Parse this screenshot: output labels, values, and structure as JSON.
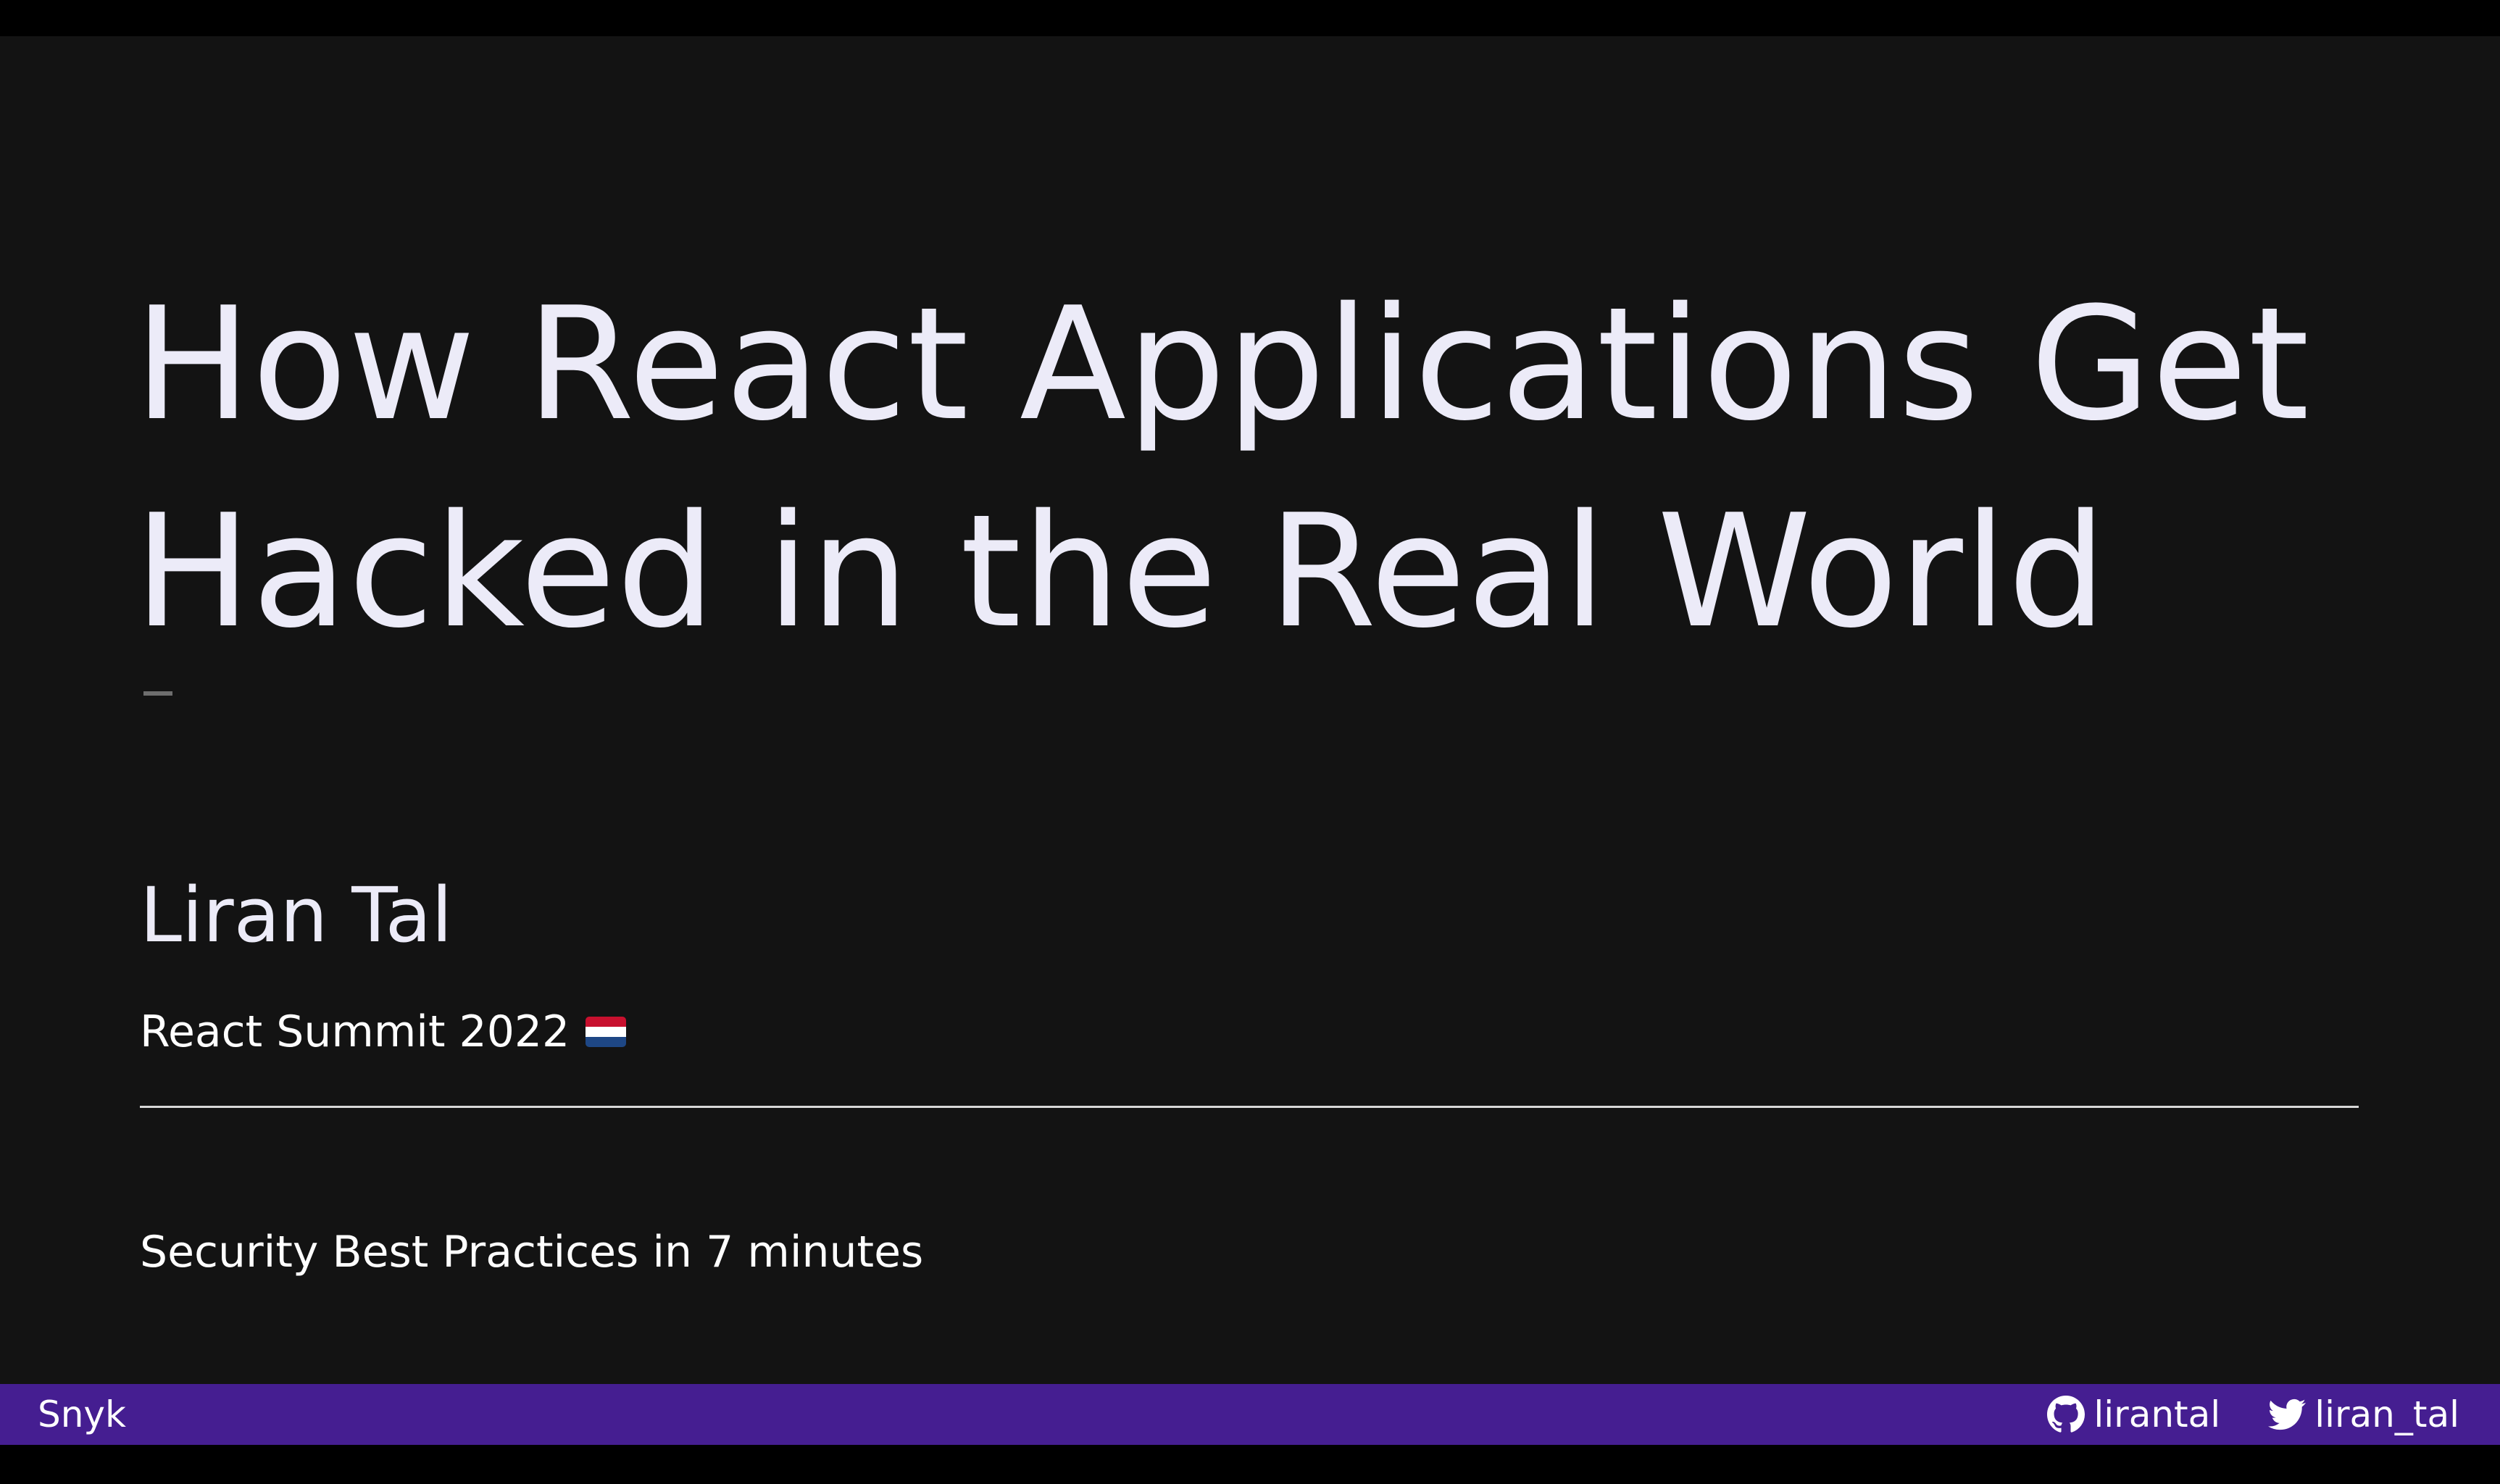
{
  "slide": {
    "title": "How React Applications Get Hacked in the Real World",
    "author": "Liran Tal",
    "event": "React Summit 2022",
    "event_flag": "netherlands-flag-icon",
    "subtitle": "Security Best Practices in 7 minutes"
  },
  "footer": {
    "brand": "Snyk",
    "github": {
      "icon": "github-icon",
      "handle": "lirantal"
    },
    "twitter": {
      "icon": "twitter-icon",
      "handle": "liran_tal"
    }
  },
  "colors": {
    "background": "#131313",
    "text": "#ecebf8",
    "footer_bg": "#451e91",
    "letterbox": "#000000"
  }
}
